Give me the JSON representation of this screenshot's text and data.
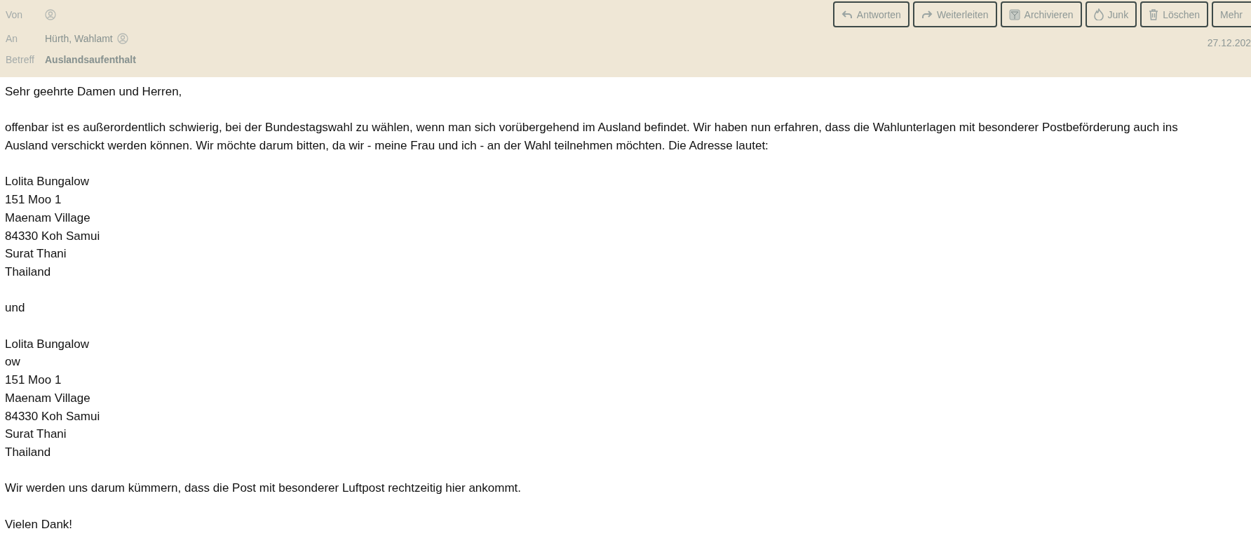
{
  "header": {
    "from": {
      "label": "Von"
    },
    "to": {
      "label": "An",
      "value": "Hürth, Wahlamt"
    },
    "subject": {
      "label": "Betreff",
      "value": "Auslandsaufenthalt"
    },
    "actions": [
      {
        "kind": "reply",
        "label": "Antworten"
      },
      {
        "kind": "forward",
        "label": "Weiterleiten"
      },
      {
        "kind": "archive",
        "label": "Archivieren"
      },
      {
        "kind": "junk",
        "label": "Junk"
      },
      {
        "kind": "delete",
        "label": "Löschen"
      },
      {
        "kind": "more",
        "label": "Mehr"
      }
    ],
    "date": "27.12.202"
  },
  "body": {
    "blocks": [
      {
        "lines": [
          "Sehr geehrte Damen und Herren,"
        ]
      },
      {
        "lines": [
          "offenbar ist es außerordentlich schwierig, bei der Bundestagswahl zu wählen, wenn man sich vorübergehend im Ausland befindet. Wir haben nun erfahren, dass die Wahlunterlagen mit besonderer Postbeförderung auch ins Ausland verschickt werden können. Wir möchte darum bitten, da wir - meine Frau und ich - an der Wahl teilnehmen möchten. Die Adresse lautet:"
        ]
      },
      {
        "lines": [
          "Lolita Bungalow",
          "151 Moo 1",
          "Maenam Village",
          "84330 Koh Samui",
          "Surat Thani",
          "Thailand"
        ]
      },
      {
        "lines": [
          "und"
        ]
      },
      {
        "lines": [
          "Lolita Bungalow",
          "ow",
          "151 Moo 1",
          "Maenam Village",
          "84330 Koh Samui",
          "Surat Thani",
          "Thailand"
        ]
      },
      {
        "lines": [
          "Wir werden uns darum kümmern, dass die Post mit besonderer Luftpost rechtzeitig hier ankommt."
        ]
      },
      {
        "lines": [
          "Vielen Dank!"
        ]
      }
    ]
  }
}
